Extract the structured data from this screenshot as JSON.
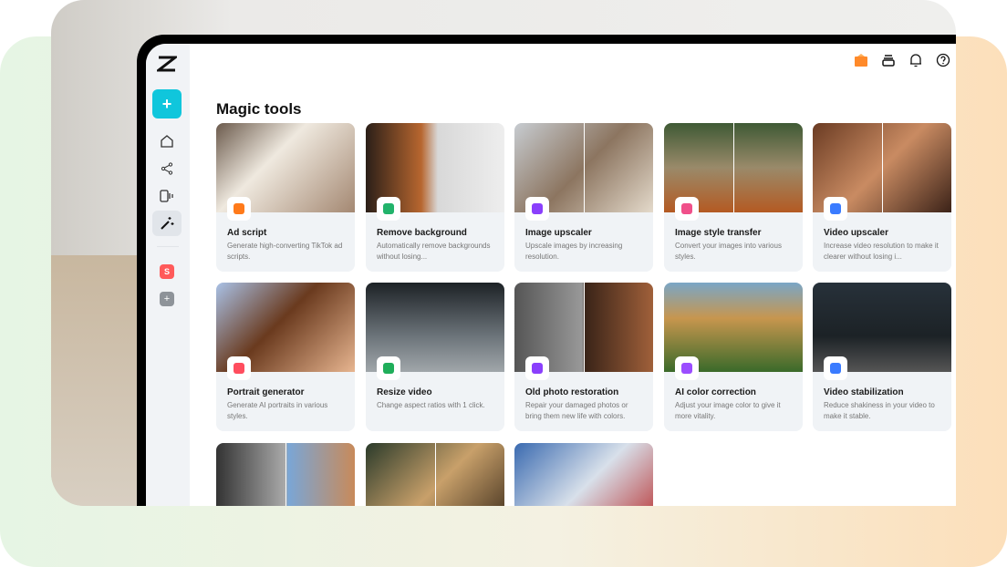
{
  "header": {
    "title": "Magic tools",
    "icons": [
      "gift-icon",
      "storage-icon",
      "bell-icon",
      "help-icon"
    ]
  },
  "sidebar": {
    "items": [
      "logo",
      "create",
      "home",
      "share",
      "video",
      "magic-tools",
      "space-s",
      "add-space"
    ],
    "space_letter": "S",
    "create_label": "+"
  },
  "tools": [
    {
      "title": "Ad script",
      "desc": "Generate high-converting TikTok ad scripts.",
      "color": "#ff7a1a"
    },
    {
      "title": "Remove background",
      "desc": "Automatically remove backgrounds without losing...",
      "color": "#22b36b"
    },
    {
      "title": "Image upscaler",
      "desc": "Upscale images by increasing resolution.",
      "color": "#8a3ffc"
    },
    {
      "title": "Image style transfer",
      "desc": "Convert your images into various styles.",
      "color": "#f0508a"
    },
    {
      "title": "Video upscaler",
      "desc": "Increase video resolution to make it clearer without losing i...",
      "color": "#3a7bff"
    },
    {
      "title": "Portrait generator",
      "desc": "Generate AI portraits in various styles.",
      "color": "#ff4d5e"
    },
    {
      "title": "Resize video",
      "desc": "Change aspect ratios with 1 click.",
      "color": "#1fae5a"
    },
    {
      "title": "Old photo restoration",
      "desc": "Repair your damaged photos or bring them new life with colors.",
      "color": "#8a3ffc"
    },
    {
      "title": "AI color correction",
      "desc": "Adjust your image color to give it more vitality.",
      "color": "#9b4dff"
    },
    {
      "title": "Video stabilization",
      "desc": "Reduce shakiness in your video to make it stable.",
      "color": "#3a7bff"
    }
  ]
}
